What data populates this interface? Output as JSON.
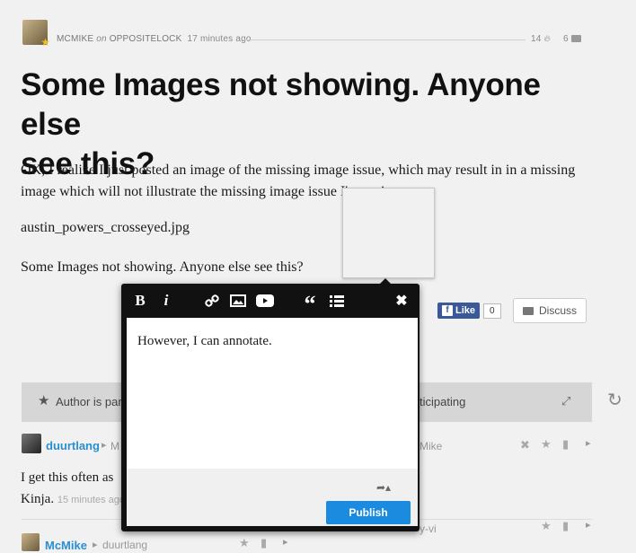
{
  "post": {
    "author": "MCMIKE",
    "on": "on",
    "blog": "OPPOSITELOCK",
    "time": "17 minutes ago",
    "likes": "14",
    "comments": "6",
    "title_line1": "Some Images not showing. Anyone else",
    "title_line2": "see this?",
    "para1_line1": "OK, I realize I just posted an image of the missing image issue, which may result in in a missing",
    "para1_line2": "image which will not illustrate the missing image issue I'm seeing.",
    "filename": "austin_powers_crosseyed.jpg",
    "para3": "Some Images not showing. Anyone else see this?"
  },
  "social": {
    "like_label": "Like",
    "like_count": "0",
    "discuss_label": "Discuss"
  },
  "discussion": {
    "bar_left": "Author is part",
    "bar_right": "ticipating"
  },
  "comments": [
    {
      "user": "duurtlang",
      "reply_to_partial": "M",
      "right_partial": "Mike",
      "text_partial": "I get this often as",
      "line2": "Kinja.",
      "time": "15 minutes ago"
    },
    {
      "user": "McMike",
      "reply_to": "duurtlang",
      "right_partial": "y-vi"
    }
  ],
  "editor": {
    "text": "However, I can annotate.",
    "publish_label": "Publish",
    "tools": [
      "bold-icon",
      "italic-icon",
      "link-icon",
      "image-icon",
      "youtube-icon",
      "quote-icon",
      "list-icon",
      "close-icon"
    ]
  }
}
